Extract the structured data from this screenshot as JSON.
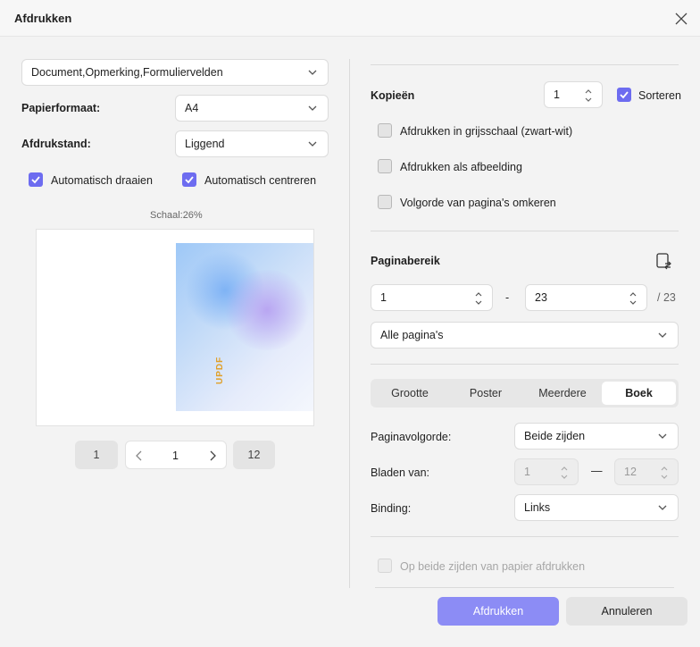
{
  "window": {
    "title": "Afdrukken"
  },
  "left": {
    "content_select": "Document,Opmerking,Formuliervelden",
    "paper_size_label": "Papierformaat:",
    "paper_size_value": "A4",
    "orientation_label": "Afdrukstand:",
    "orientation_value": "Liggend",
    "auto_rotate_label": "Automatisch draaien",
    "auto_rotate_checked": true,
    "auto_center_label": "Automatisch centreren",
    "auto_center_checked": true,
    "scale_text": "Schaal:26%",
    "preview_brand": "UPDF",
    "pager": {
      "first": "1",
      "current": "1",
      "last": "12"
    }
  },
  "right": {
    "copies_label": "Kopieën",
    "copies_value": "1",
    "collate_label": "Sorteren",
    "collate_checked": true,
    "grayscale_label": "Afdrukken in grijsschaal (zwart-wit)",
    "as_image_label": "Afdrukken als afbeelding",
    "reverse_label": "Volgorde van pagina's omkeren",
    "page_range_label": "Paginabereik",
    "range_from": "1",
    "range_sep": "-",
    "range_to": "23",
    "range_total": "/ 23",
    "range_select": "Alle pagina's",
    "tabs": [
      "Grootte",
      "Poster",
      "Meerdere",
      "Boek"
    ],
    "active_tab": "Boek",
    "page_order_label": "Paginavolgorde:",
    "page_order_value": "Beide zijden",
    "sheets_label": "Bladen van:",
    "sheets_from": "1",
    "sheets_sep": "—",
    "sheets_to": "12",
    "binding_label": "Binding:",
    "binding_value": "Links",
    "duplex_label": "Op beide zijden van papier afdrukken"
  },
  "footer": {
    "print_label": "Afdrukken",
    "cancel_label": "Annuleren"
  },
  "colors": {
    "accent": "#6d6cf0",
    "primary_button": "#8c8cf5",
    "background": "#f3f3f3"
  }
}
